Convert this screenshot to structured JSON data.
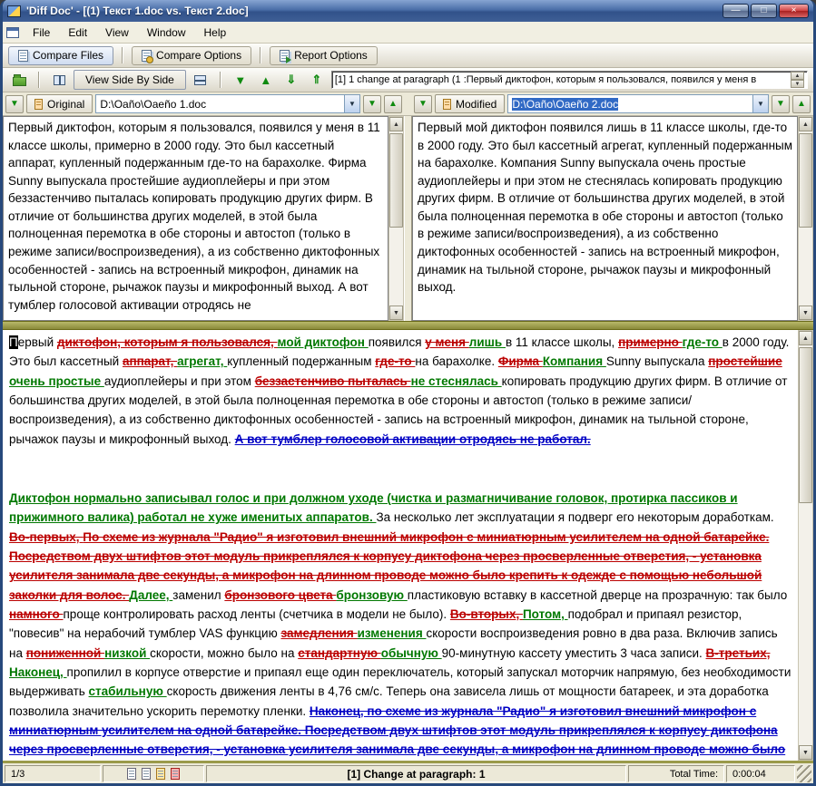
{
  "window": {
    "title": "'Diff Doc' - [(1) Текст 1.doc vs. Текст 2.doc]",
    "controls": {
      "minimize": "—",
      "maximize": "□",
      "close": "×"
    }
  },
  "icons": {
    "up": "▲",
    "down": "▼",
    "dropdown": "▼"
  },
  "menu": {
    "items": [
      "File",
      "Edit",
      "View",
      "Window",
      "Help"
    ]
  },
  "tabs": [
    {
      "label": "Compare Files"
    },
    {
      "label": "Compare Options"
    },
    {
      "label": "Report Options"
    }
  ],
  "nav": {
    "view_side_by_side": "View Side By Side",
    "arrows": [
      "▼",
      "▲",
      "⇓",
      "⇑"
    ],
    "readout": "[1] 1 change at paragraph (1 :Первый диктофон, которым я пользовался, появился у меня в"
  },
  "panes": {
    "original": {
      "label": "Original",
      "path": "D:\\Oaño\\Oaeño 1.doc",
      "text": "Первый диктофон, которым я пользовался, появился у меня в 11 классе школы, примерно в 2000 году. Это был кассетный аппарат, купленный подержанным где-то на барахолке. Фирма Sunny выпускала простейшие аудиоплейеры и при этом беззастенчиво пыталась копировать продукцию других фирм. В отличие от большинства других моделей, в этой была полноценная перемотка в обе стороны и автостоп (только в режиме записи/воспроизведения), а из собственно диктофонных особенностей - запись на встроенный микрофон, динамик на тыльной стороне, рычажок паузы и микрофонный выход. А вот тумблер голосовой активации отродясь не"
    },
    "modified": {
      "label": "Modified",
      "path": "D:\\Oaño\\Oaeño 2.doc",
      "text": "Первый мой диктофон появился лишь в 11 классе школы, где-то в 2000 году. Это был кассетный агрегат, купленный подержанным на барахолке. Компания Sunny выпускала очень простые аудиоплейеры и при этом не стеснялась копировать продукцию других фирм. В отличие от большинства других моделей, в этой была полноценная перемотка в обе стороны и автостоп (только в режиме записи/воспроизведения), а из собственно диктофонных особенностей - запись на встроенный микрофон, динамик на тыльной стороне, рычажок паузы и микрофонный выход."
    }
  },
  "diff": {
    "paragraphs": [
      [
        {
          "t": "П",
          "s": "c"
        },
        {
          "t": "ервый ",
          "s": "n"
        },
        {
          "t": "диктофон, которым я пользовался, ",
          "s": "d"
        },
        {
          "t": "мой диктофон ",
          "s": "i"
        },
        {
          "t": "появился ",
          "s": "n"
        },
        {
          "t": "у меня ",
          "s": "d"
        },
        {
          "t": "лишь ",
          "s": "i"
        },
        {
          "t": "в 11 классе школы, ",
          "s": "n"
        },
        {
          "t": "примерно ",
          "s": "d"
        },
        {
          "t": "где-то ",
          "s": "i"
        },
        {
          "t": "в 2000 году. Это был кассетный ",
          "s": "n"
        },
        {
          "t": "аппарат, ",
          "s": "d"
        },
        {
          "t": "агрегат, ",
          "s": "i"
        },
        {
          "t": "купленный подержанным ",
          "s": "n"
        },
        {
          "t": "где-то ",
          "s": "d"
        },
        {
          "t": "на барахолке. ",
          "s": "n"
        },
        {
          "t": "Фирма ",
          "s": "d"
        },
        {
          "t": "Компания ",
          "s": "i"
        },
        {
          "t": "Sunny выпускала ",
          "s": "n"
        },
        {
          "t": "простейшие ",
          "s": "d"
        },
        {
          "t": "очень простые ",
          "s": "i"
        },
        {
          "t": "аудиоплейеры и при этом ",
          "s": "n"
        },
        {
          "t": "беззастенчиво пыталась ",
          "s": "d"
        },
        {
          "t": "не стеснялась ",
          "s": "i"
        },
        {
          "t": "копировать продукцию других фирм. В отличие от большинства других моделей, в этой была полноценная перемотка в обе стороны и автостоп (только в режиме записи/воспроизведения), а из собственно диктофонных особенностей - запись на встроенный микрофон, динамик на тыльной стороне, рычажок паузы и микрофонный выход. ",
          "s": "n"
        },
        {
          "t": "А вот тумблер голосовой активации отродясь не работал.",
          "s": "m"
        }
      ],
      [
        {
          "t": "Диктофон нормально записывал голос и при должном уходе (чистка и размагничивание головок, протирка пассиков и прижимного валика) работал не хуже именитых аппаратов. ",
          "s": "i"
        },
        {
          "t": "За несколько лет эксплуатации я подверг его некоторым доработкам. ",
          "s": "n"
        },
        {
          "t": "Во-первых, ",
          "s": "d"
        },
        {
          "t": "По схеме из журнала \"Радио\" я изготовил внешний микрофон с миниатюрным усилителем на одной батарейке. Посредством двух штифтов этот модуль прикреплялся к корпусу диктофона через просверленные отверстия, - установка усилителя занимала две секунды, а микрофон на длинном проводе можно было крепить к одежде с помощью небольшой заколки для волос. ",
          "s": "d"
        },
        {
          "t": "Далее, ",
          "s": "i"
        },
        {
          "t": "заменил ",
          "s": "n"
        },
        {
          "t": "бронзового цвета ",
          "s": "d"
        },
        {
          "t": "бронзовую ",
          "s": "i"
        },
        {
          "t": "пластиковую вставку в кассетной дверце на прозрачную: так было ",
          "s": "n"
        },
        {
          "t": "намного ",
          "s": "d"
        },
        {
          "t": "проще контролировать расход ленты (счетчика в модели не было). ",
          "s": "n"
        },
        {
          "t": "Во-вторых, ",
          "s": "d"
        },
        {
          "t": "Потом, ",
          "s": "i"
        },
        {
          "t": "подобрал и припаял резистор, \"повесив\" на нерабочий тумблер VAS функцию ",
          "s": "n"
        },
        {
          "t": "замедления ",
          "s": "d"
        },
        {
          "t": "изменения ",
          "s": "i"
        },
        {
          "t": "скорости воспроизведения ровно в два раза. Включив запись на ",
          "s": "n"
        },
        {
          "t": "пониженной ",
          "s": "d"
        },
        {
          "t": "низкой ",
          "s": "i"
        },
        {
          "t": "скорости, можно было на ",
          "s": "n"
        },
        {
          "t": "стандартную ",
          "s": "d"
        },
        {
          "t": "обычную ",
          "s": "i"
        },
        {
          "t": "90-минутную кассету уместить 3 часа записи. ",
          "s": "n"
        },
        {
          "t": "В-третьих, ",
          "s": "d"
        },
        {
          "t": "Наконец, ",
          "s": "i"
        },
        {
          "t": "пропилил в корпусе отверстие и припаял еще один переключатель, который запускал моторчик напрямую, без необходимости выдерживать ",
          "s": "n"
        },
        {
          "t": "стабильную ",
          "s": "i"
        },
        {
          "t": "скорость движения ленты в 4,76 см/с. Теперь она зависела лишь от мощности батареек, и эта доработка позволила значительно ускорить перемотку пленки. ",
          "s": "n"
        },
        {
          "t": "Наконец, по схеме из журнала \"Радио\" я изготовил внешний микрофон с миниатюрным усилителем на одной батарейке. Посредством двух штифтов этот модуль прикреплялся к корпусу диктофона через просверленные отверстия, - установка усилителя занимала две секунды, а микрофон на длинном проводе можно было крепить к одежде с помощью небольшой заколки для волос.",
          "s": "m"
        }
      ]
    ]
  },
  "status": {
    "page": "1/3",
    "change": "[1] Change at paragraph: 1",
    "total_time_label": "Total Time:",
    "total_time": "0:00:04"
  }
}
